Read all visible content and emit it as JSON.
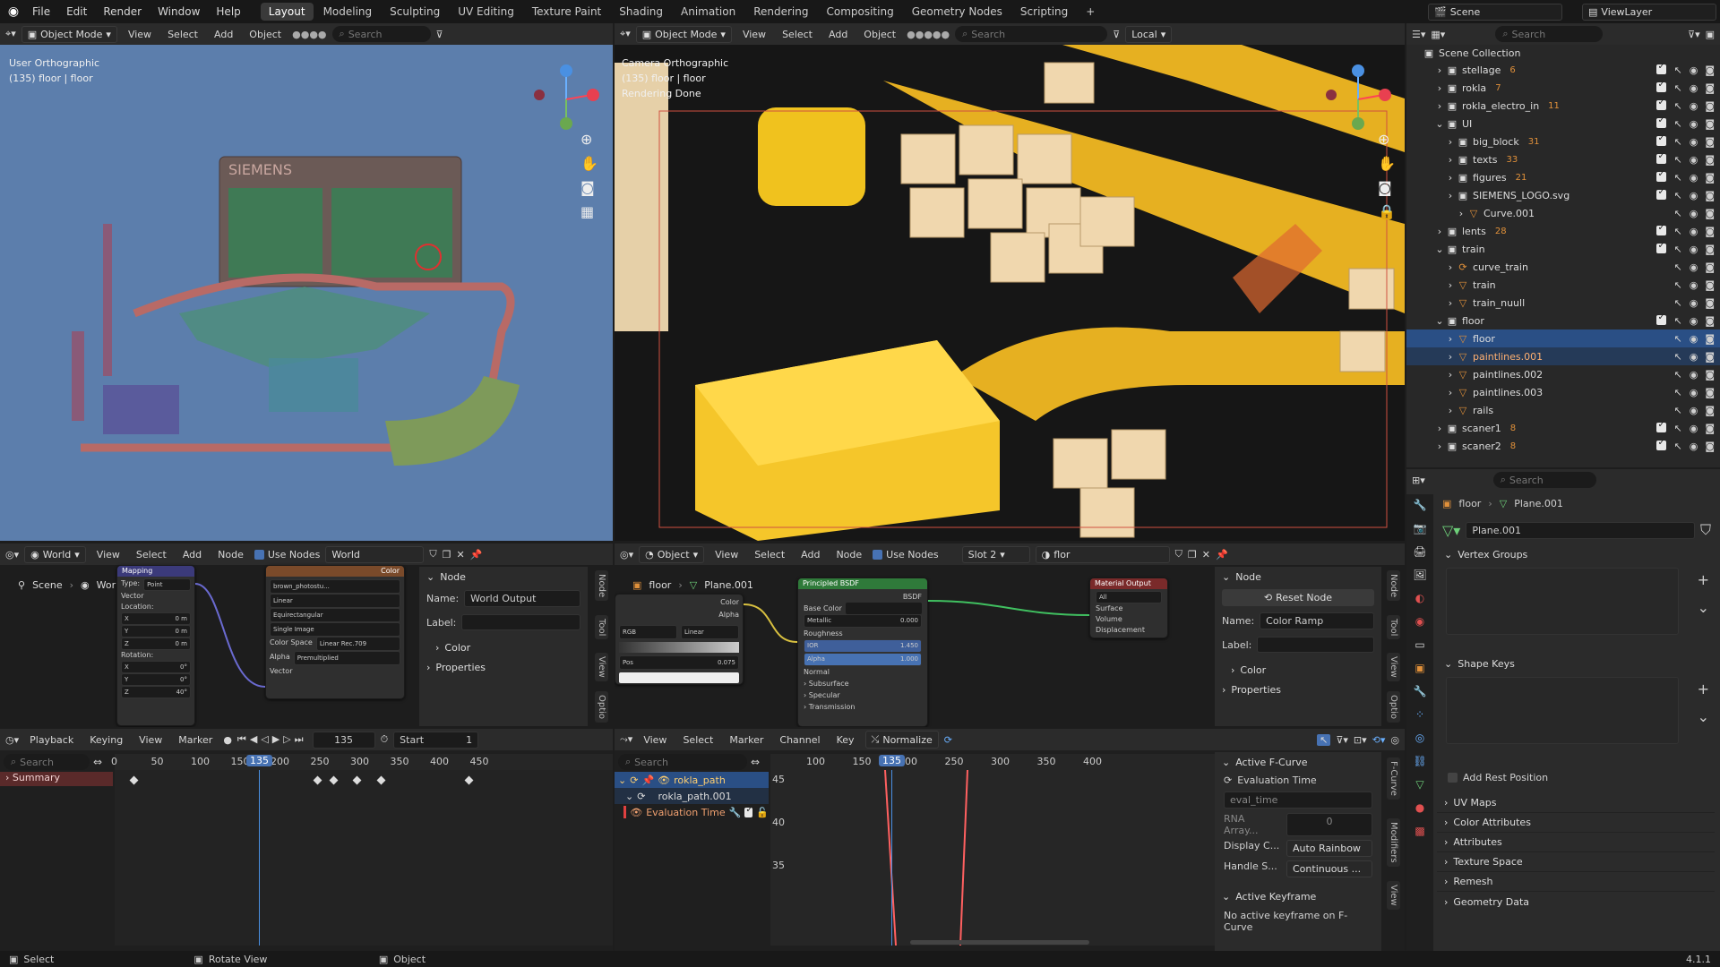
{
  "topbar": {
    "menus": [
      "File",
      "Edit",
      "Render",
      "Window",
      "Help"
    ],
    "workspaces": [
      "Layout",
      "Modeling",
      "Sculpting",
      "UV Editing",
      "Texture Paint",
      "Shading",
      "Animation",
      "Rendering",
      "Compositing",
      "Geometry Nodes",
      "Scripting"
    ],
    "active_workspace": "Layout",
    "plus": "+",
    "scene": "Scene",
    "view_layer": "ViewLayer"
  },
  "viewport_left": {
    "mode": "Object Mode",
    "menus": [
      "View",
      "Select",
      "Add",
      "Object"
    ],
    "search_placeholder": "Search",
    "info_line1": "User Orthographic",
    "info_line2": "(135) floor | floor",
    "logo_text": "SIEMENS"
  },
  "viewport_right": {
    "mode": "Object Mode",
    "menus": [
      "View",
      "Select",
      "Add",
      "Object"
    ],
    "search_placeholder": "Search",
    "orientation": "Local",
    "info_line1": "Camera Orthographic",
    "info_line2": "(135) floor | floor",
    "info_line3": "Rendering Done"
  },
  "outliner": {
    "search_placeholder": "Search",
    "root": "Scene Collection",
    "rows": [
      {
        "name": "stellage",
        "depth": 1,
        "type": "collection",
        "badge": "6"
      },
      {
        "name": "rokla",
        "depth": 1,
        "type": "collection",
        "badge": "7"
      },
      {
        "name": "rokla_electro_in",
        "depth": 1,
        "type": "collection",
        "badge": "11"
      },
      {
        "name": "UI",
        "depth": 1,
        "type": "collection",
        "badge": ""
      },
      {
        "name": "big_block",
        "depth": 2,
        "type": "collection",
        "badge": "31"
      },
      {
        "name": "texts",
        "depth": 2,
        "type": "collection",
        "badge": "33"
      },
      {
        "name": "figures",
        "depth": 2,
        "type": "collection",
        "badge": "21"
      },
      {
        "name": "SIEMENS_LOGO.svg",
        "depth": 2,
        "type": "collection",
        "badge": ""
      },
      {
        "name": "Curve.001",
        "depth": 3,
        "type": "object",
        "badge": ""
      },
      {
        "name": "lents",
        "depth": 1,
        "type": "collection",
        "badge": "28"
      },
      {
        "name": "train",
        "depth": 1,
        "type": "collection",
        "badge": ""
      },
      {
        "name": "curve_train",
        "depth": 2,
        "type": "curve",
        "badge": ""
      },
      {
        "name": "train",
        "depth": 2,
        "type": "object",
        "badge": ""
      },
      {
        "name": "train_nuull",
        "depth": 2,
        "type": "object",
        "badge": ""
      },
      {
        "name": "floor",
        "depth": 1,
        "type": "collection",
        "badge": ""
      },
      {
        "name": "floor",
        "depth": 2,
        "type": "object",
        "badge": "",
        "selected": true
      },
      {
        "name": "paintlines.001",
        "depth": 2,
        "type": "object",
        "badge": "",
        "selected2": true
      },
      {
        "name": "paintlines.002",
        "depth": 2,
        "type": "object",
        "badge": ""
      },
      {
        "name": "paintlines.003",
        "depth": 2,
        "type": "object",
        "badge": ""
      },
      {
        "name": "rails",
        "depth": 2,
        "type": "object",
        "badge": ""
      },
      {
        "name": "scaner1",
        "depth": 1,
        "type": "collection",
        "badge": "8"
      },
      {
        "name": "scaner2",
        "depth": 1,
        "type": "collection",
        "badge": "8"
      }
    ]
  },
  "properties": {
    "search_placeholder": "Search",
    "breadcrumb_obj": "floor",
    "breadcrumb_data": "Plane.001",
    "data_name": "Plane.001",
    "sections": [
      "Vertex Groups",
      "Shape Keys"
    ],
    "add_rest_position": "Add Rest Position",
    "collapsed_sections": [
      "UV Maps",
      "Color Attributes",
      "Attributes",
      "Texture Space",
      "Remesh",
      "Geometry Data"
    ]
  },
  "world_editor": {
    "type": "World",
    "menus": [
      "View",
      "Select",
      "Add",
      "Node"
    ],
    "use_nodes": "Use Nodes",
    "world_name": "World",
    "breadcrumb_scene": "Scene",
    "breadcrumb_world": "World",
    "node_panel": {
      "header": "Node",
      "name_label": "Name:",
      "name_value": "World Output",
      "label_label": "Label:",
      "color": "Color",
      "properties": "Properties"
    },
    "mapping_node": {
      "title": "Mapping",
      "type_label": "Type:",
      "type_value": "Point",
      "vector": "Vector",
      "location": "Location:",
      "rotation": "Rotation:",
      "x": "X",
      "y": "Y",
      "z": "Z",
      "loc_vals": [
        "0 m",
        "0 m",
        "0 m"
      ],
      "rot_vals": [
        "0°",
        "0°",
        "40°"
      ]
    },
    "image_node": {
      "file": "brown_photostu...",
      "interp": "Linear",
      "proj": "Equirectangular",
      "ext": "Single Image",
      "cs_label": "Color Space",
      "cs_value": "Linear Rec.709",
      "alpha_label": "Alpha",
      "alpha_value": "Premultiplied",
      "color": "Color",
      "vector": "Vector"
    }
  },
  "shader_editor": {
    "type": "Object",
    "menus": [
      "View",
      "Select",
      "Add",
      "Node"
    ],
    "use_nodes": "Use Nodes",
    "slot": "Slot 2",
    "material": "flor",
    "breadcrumb_obj": "floor",
    "breadcrumb_data": "Plane.001",
    "node_panel": {
      "header": "Node",
      "reset": "Reset Node",
      "name_label": "Name:",
      "name_value": "Color Ramp",
      "label_label": "Label:",
      "color": "Color",
      "properties": "Properties"
    },
    "bsdf": {
      "title": "Principled BSDF",
      "out": "BSDF",
      "base_color": "Base Color",
      "metallic": "Metallic",
      "metallic_val": "0.000",
      "roughness": "Roughness",
      "ior": "IOR",
      "ior_val": "1.450",
      "alpha": "Alpha",
      "alpha_val": "1.000",
      "normal": "Normal",
      "subsurface": "Subsurface",
      "specular": "Specular",
      "transmission": "Transmission"
    },
    "ramp": {
      "title": "Color Ramp",
      "color": "Color",
      "alpha": "Alpha",
      "mode": "RGB",
      "interp": "Linear",
      "pos_label": "Pos",
      "pos_val": "0.075"
    },
    "output": {
      "title": "Material Output",
      "target": "All",
      "surface": "Surface",
      "volume": "Volume",
      "displacement": "Displacement"
    }
  },
  "dopesheet": {
    "menus": [
      "Playback",
      "Keying",
      "View",
      "Marker"
    ],
    "frame": "135",
    "start_label": "Start",
    "start_val": "1",
    "search_placeholder": "Search",
    "ticks": [
      "0",
      "50",
      "100",
      "150",
      "200",
      "250",
      "300",
      "350",
      "400",
      "450"
    ],
    "current": "135",
    "summary": "Summary"
  },
  "graph": {
    "menus": [
      "View",
      "Select",
      "Marker",
      "Channel",
      "Key"
    ],
    "normalize": "Normalize",
    "search_placeholder": "Search",
    "ticks": [
      "100",
      "150",
      "200",
      "250",
      "300",
      "350",
      "400"
    ],
    "current": "135",
    "yticks": [
      "45",
      "40",
      "35"
    ],
    "channels": [
      "rokla_path",
      "rokla_path.001",
      "Evaluation Time"
    ],
    "panel": {
      "active_fcurve": "Active F-Curve",
      "eval_time": "Evaluation Time",
      "eval_field": "eval_time",
      "rna_label": "RNA Array...",
      "rna_val": "0",
      "display_label": "Display C...",
      "display_val": "Auto Rainbow",
      "handle_label": "Handle S...",
      "handle_val": "Continuous ...",
      "active_kf": "Active Keyframe",
      "no_kf": "No active keyframe on F-Curve"
    }
  },
  "statusbar": {
    "select": "Select",
    "rotate": "Rotate View",
    "object": "Object",
    "version": "4.1.1"
  },
  "side_tabs": {
    "node": "Node",
    "tool": "Tool",
    "view": "View",
    "options": "Optio",
    "fcurve": "F-Curve",
    "modifiers": "Modifiers"
  },
  "colors": {
    "accent": "#4772b3",
    "selected_row": "#2a4f85",
    "bsdf_header": "#2f7a3a",
    "output_header": "#7a2a2a",
    "viewport_bg": "#5b7dab",
    "yellow": "#f0c020"
  }
}
